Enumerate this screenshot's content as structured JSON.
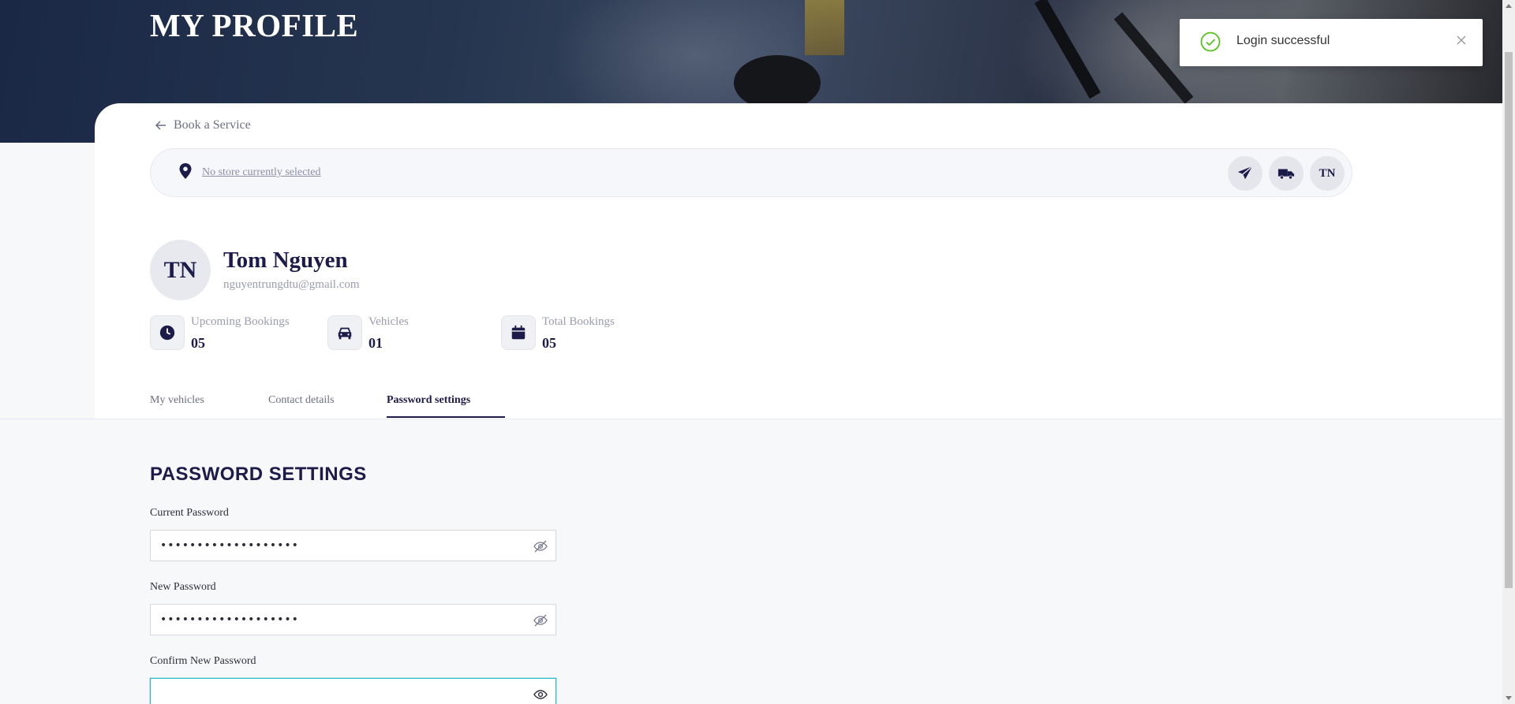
{
  "hero": {
    "title": "MY PROFILE"
  },
  "back_link": {
    "label": "Book a Service"
  },
  "store_bar": {
    "store_text": "No store currently selected",
    "user_initials": "TN"
  },
  "profile": {
    "initials": "TN",
    "name": "Tom Nguyen",
    "email": "nguyentrungdtu@gmail.com"
  },
  "stats": [
    {
      "label": "Upcoming Bookings",
      "value": "05",
      "icon": "clock-icon"
    },
    {
      "label": "Vehicles",
      "value": "01",
      "icon": "car-icon"
    },
    {
      "label": "Total Bookings",
      "value": "05",
      "icon": "calendar-icon"
    }
  ],
  "tabs": [
    {
      "label": "My vehicles",
      "active": false
    },
    {
      "label": "Contact details",
      "active": false
    },
    {
      "label": "Password settings",
      "active": true
    }
  ],
  "password_settings": {
    "title": "PASSWORD SETTINGS",
    "fields": [
      {
        "label": "Current Password",
        "value": "•••••••••••••••••••",
        "visibility": "hidden"
      },
      {
        "label": "New Password",
        "value": "•••••••••••••••••••",
        "visibility": "hidden"
      },
      {
        "label": "Confirm New Password",
        "value": "",
        "visibility": "visible"
      }
    ]
  },
  "toast": {
    "message": "Login successful"
  },
  "colors": {
    "accent": "#1c1b4a",
    "focus": "#22b8c6",
    "success": "#52c41a"
  }
}
